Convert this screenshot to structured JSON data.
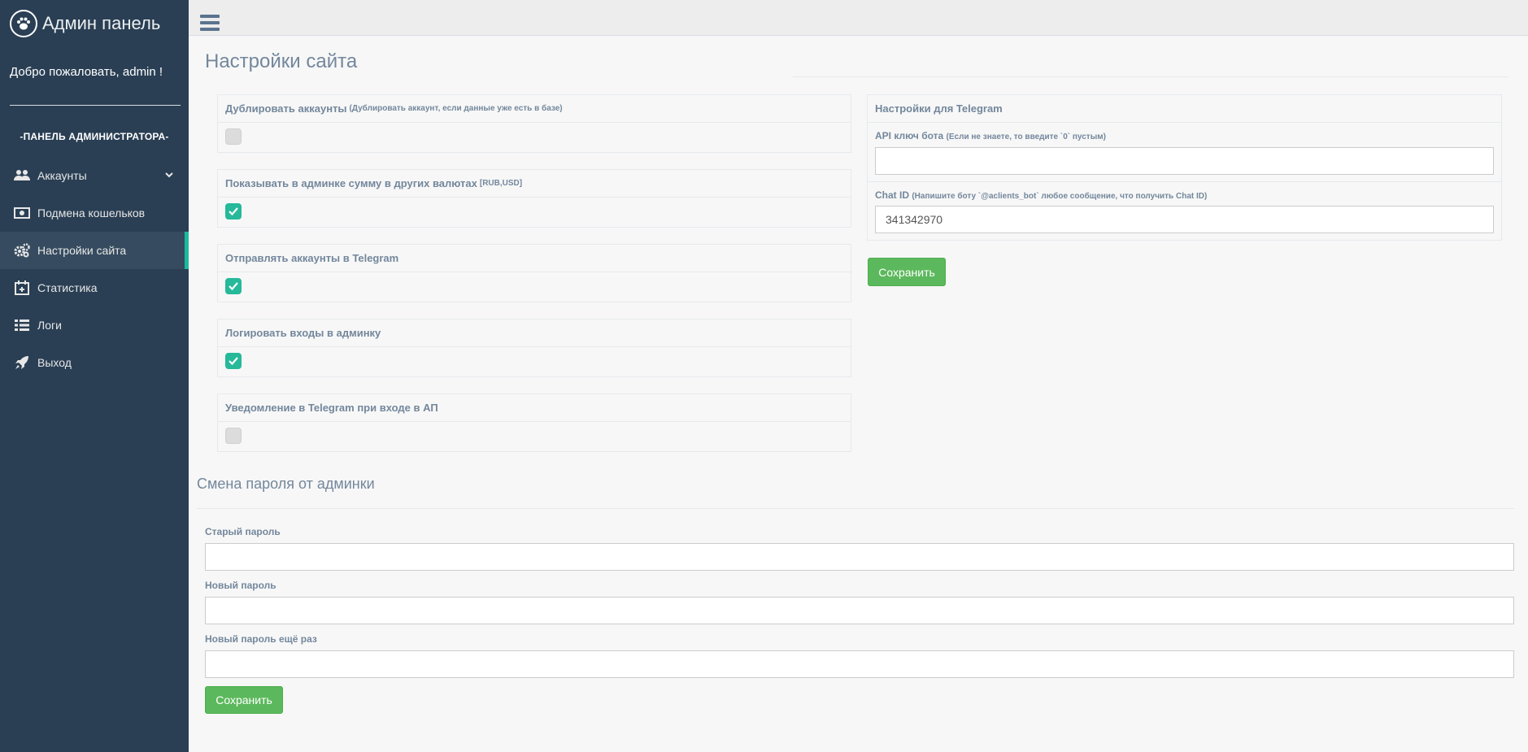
{
  "brand": {
    "title": "Админ панель",
    "icon": "paw-icon"
  },
  "welcome": "Добро пожаловать, admin !",
  "section_label": "-ПАНЕЛЬ АДМИНИСТРАТОРА-",
  "menu": [
    {
      "label": "Аккаунты",
      "icon": "users-icon",
      "has_submenu": true
    },
    {
      "label": "Подмена кошельков",
      "icon": "money-icon"
    },
    {
      "label": "Настройки сайта",
      "icon": "cogs-icon",
      "active": true
    },
    {
      "label": "Статистика",
      "icon": "calendar-plus-icon"
    },
    {
      "label": "Логи",
      "icon": "list-icon"
    },
    {
      "label": "Выход",
      "icon": "rocket-icon"
    }
  ],
  "page": {
    "title": "Настройки сайта"
  },
  "settings": [
    {
      "label": "Дублировать аккаунты",
      "hint": "(Дублировать аккаунт, если данные уже есть в базе)",
      "checked": false
    },
    {
      "label": "Показывать в админке сумму в других валютах",
      "hint": "[RUB,USD]",
      "checked": true
    },
    {
      "label": "Отправлять аккаунты в Telegram",
      "hint": "",
      "checked": true
    },
    {
      "label": "Логировать входы в админку",
      "hint": "",
      "checked": true
    },
    {
      "label": "Уведомление в Telegram при входе в АП",
      "hint": "",
      "checked": false
    }
  ],
  "telegram": {
    "title": "Настройки для Telegram",
    "api_label": "API ключ бота",
    "api_hint": "(Если не знаете, то введите `0` пустым)",
    "api_value": "",
    "chat_label": "Chat ID",
    "chat_hint": "(Напишите боту `@aclients_bot` любое сообщение, что получить Chat ID)",
    "chat_value": "341342970",
    "save_label": "Сохранить"
  },
  "password": {
    "title": "Смена пароля от админки",
    "old_label": "Старый пароль",
    "new_label": "Новый пароль",
    "repeat_label": "Новый пароль ещё раз",
    "save_label": "Сохранить"
  },
  "colors": {
    "sidebar": "#2a3f54",
    "accent": "#1abb9c",
    "checkbox_on": "#26b99a",
    "button": "#5cb85c"
  }
}
